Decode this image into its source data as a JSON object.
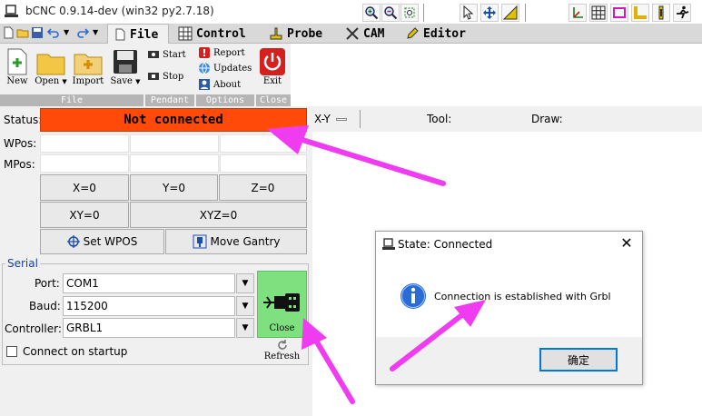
{
  "window": {
    "title": "bCNC 0.9.14-dev (win32 py2.7.18)"
  },
  "tabs": [
    {
      "label": "File",
      "active": true
    },
    {
      "label": "Control"
    },
    {
      "label": "Probe"
    },
    {
      "label": "CAM"
    },
    {
      "label": "Editor"
    }
  ],
  "ribbon": {
    "file_group": {
      "label": "File",
      "buttons": [
        "New",
        "Open",
        "Import",
        "Save"
      ]
    },
    "pendant_group": {
      "label": "Pendant",
      "start": "Start",
      "stop": "Stop"
    },
    "options_group": {
      "label": "Options",
      "report": "Report",
      "updates": "Updates",
      "about": "About"
    },
    "close_group": {
      "label": "Close",
      "exit": "Exit"
    }
  },
  "status": {
    "label": "Status:",
    "value": "Not connected",
    "color": "#ff4a0a"
  },
  "wpos": {
    "label": "WPos:"
  },
  "mpos": {
    "label": "MPos:"
  },
  "zero_buttons": {
    "x": "X=0",
    "y": "Y=0",
    "z": "Z=0",
    "xy": "XY=0",
    "xyz": "XYZ=0"
  },
  "set_wpos": "Set WPOS",
  "move_gantry": "Move Gantry",
  "serial": {
    "legend": "Serial",
    "port_label": "Port:",
    "port_value": "COM1",
    "baud_label": "Baud:",
    "baud_value": "115200",
    "controller_label": "Controller:",
    "controller_value": "GRBL1",
    "close_button": "Close",
    "refresh_button": "Refresh",
    "connect_on_startup": "Connect on startup",
    "connect_on_startup_checked": false
  },
  "toolbar": {
    "view": "X-Y",
    "tool_label": "Tool:",
    "draw_label": "Draw:"
  },
  "dialog": {
    "title": "State: Connected",
    "message": "Connection is established with Grbl",
    "ok": "确定"
  },
  "colors": {
    "accent_close": "#7ee07e",
    "annotation_arrow": "#f03cf0"
  }
}
